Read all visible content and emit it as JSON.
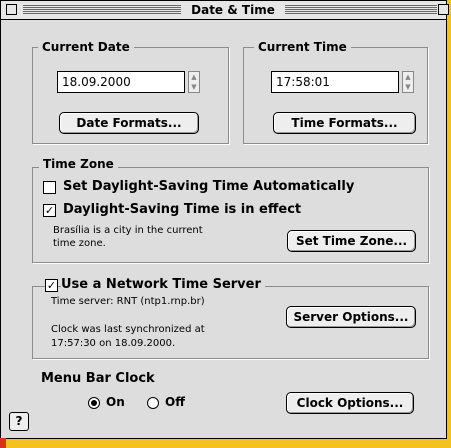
{
  "window": {
    "title": "Date & Time"
  },
  "current_date": {
    "label": "Current Date",
    "value": "18.09.2000",
    "button": "Date Formats..."
  },
  "current_time": {
    "label": "Current Time",
    "value": "17:58:01",
    "button": "Time Formats..."
  },
  "time_zone": {
    "label": "Time Zone",
    "dst_auto": {
      "label": "Set Daylight-Saving Time Automatically",
      "checked": false
    },
    "dst_in_effect": {
      "label": "Daylight-Saving Time is in effect",
      "checked": true
    },
    "info_line1": "Brasília is a city in the current",
    "info_line2": "time zone.",
    "button": "Set Time Zone..."
  },
  "network": {
    "label": "Use a Network Time Server",
    "checked": true,
    "server_text": "Time server: RNT (ntp1.rnp.br)",
    "sync_line1": "Clock was last synchronized at",
    "sync_line2": "17:57:30 on 18.09.2000.",
    "button": "Server Options..."
  },
  "menu_bar_clock": {
    "label": "Menu Bar Clock",
    "on_label": "On",
    "off_label": "Off",
    "selected": "On",
    "button": "Clock Options..."
  },
  "help": {
    "label": "?"
  },
  "colors": {
    "desktop": "#f4c21e",
    "window": "#dddddd"
  }
}
